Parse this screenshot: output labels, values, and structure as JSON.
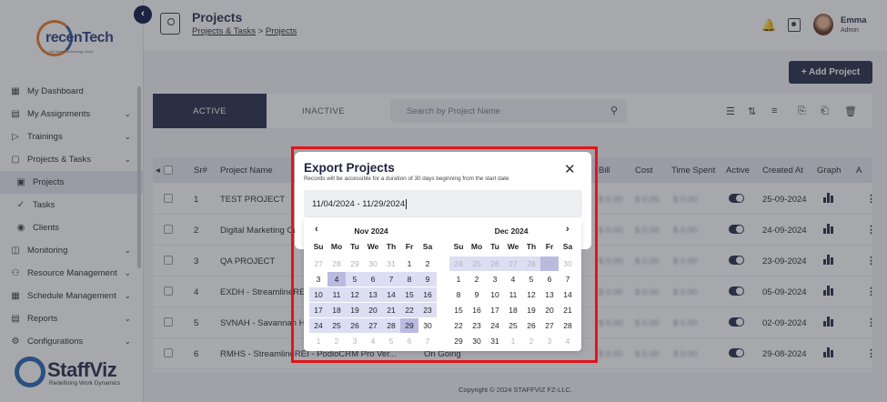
{
  "sidebar": {
    "logo_text": "recenTech",
    "logo_tagline": "We Make Technology Work",
    "items": [
      {
        "label": "My Dashboard",
        "icon": "dashboard-icon",
        "chevron": false
      },
      {
        "label": "My Assignments",
        "icon": "clipboard-icon",
        "chevron": true
      },
      {
        "label": "Trainings",
        "icon": "play-icon",
        "chevron": true
      },
      {
        "label": "Projects & Tasks",
        "icon": "folder-icon",
        "chevron": true
      },
      {
        "label": "Projects",
        "icon": "project-icon",
        "chevron": false,
        "sub": true,
        "active": true
      },
      {
        "label": "Tasks",
        "icon": "check-icon",
        "chevron": false,
        "sub": true
      },
      {
        "label": "Clients",
        "icon": "person-icon",
        "chevron": false,
        "sub": true
      },
      {
        "label": "Monitoring",
        "icon": "monitor-icon",
        "chevron": true
      },
      {
        "label": "Resource Management",
        "icon": "people-icon",
        "chevron": true
      },
      {
        "label": "Schedule Management",
        "icon": "calendar-icon",
        "chevron": true
      },
      {
        "label": "Reports",
        "icon": "report-icon",
        "chevron": true
      },
      {
        "label": "Configurations",
        "icon": "gear-icon",
        "chevron": true
      }
    ],
    "brand_name": "StaffViz",
    "brand_tagline": "Redefining Work Dynamics"
  },
  "header": {
    "title": "Projects",
    "crumb_parent": "Projects & Tasks",
    "crumb_sep": ">",
    "crumb_current": "Projects",
    "user_name": "Emma",
    "user_role": "Admin"
  },
  "main": {
    "add_button": "+ Add Project",
    "tab_active": "ACTIVE",
    "tab_inactive": "INACTIVE",
    "search_placeholder": "Search by Project Name",
    "columns": [
      "Sr#",
      "Project Name",
      "Bill",
      "Cost",
      "Time Spent",
      "Active",
      "Created At",
      "Graph",
      "A"
    ],
    "rows": [
      {
        "sr": "1",
        "name": "TEST PROJECT",
        "created": "25-09-2024"
      },
      {
        "sr": "2",
        "name": "Digital Marketing Ca",
        "created": "24-09-2024"
      },
      {
        "sr": "3",
        "name": "QA PROJECT",
        "created": "23-09-2024"
      },
      {
        "sr": "4",
        "name": "EXDH - StreamlineREI",
        "created": "05-09-2024"
      },
      {
        "sr": "5",
        "name": "SVNAH - Savannah Ho",
        "created": "02-09-2024"
      },
      {
        "sr": "6",
        "name": "RMHS - StreamlineREI - PodioCRM Pro Ver...",
        "status": "On Going",
        "created": "29-08-2024"
      }
    ],
    "masked_value": "$ 0.00",
    "footer": "Copyright © 2024 STAFFVIZ FZ-LLC."
  },
  "modal": {
    "title": "Export Projects",
    "subtitle": "Records will be accessible for a duration of 30 days beginning from the start date",
    "date_range": "11/04/2024 - 11/29/2024",
    "weekdays": [
      "Su",
      "Mo",
      "Tu",
      "We",
      "Th",
      "Fr",
      "Sa"
    ],
    "left_month": "Nov 2024",
    "right_month": "Dec 2024",
    "left_days": [
      [
        "27",
        "28",
        "29",
        "30",
        "31",
        "1",
        "2"
      ],
      [
        "3",
        "4",
        "5",
        "6",
        "7",
        "8",
        "9"
      ],
      [
        "10",
        "11",
        "12",
        "13",
        "14",
        "15",
        "16"
      ],
      [
        "17",
        "18",
        "19",
        "20",
        "21",
        "22",
        "23"
      ],
      [
        "24",
        "25",
        "26",
        "27",
        "28",
        "29",
        "30"
      ],
      [
        "1",
        "2",
        "3",
        "4",
        "5",
        "6",
        "7"
      ]
    ],
    "right_days": [
      [
        "24",
        "25",
        "26",
        "27",
        "28",
        "29",
        "30"
      ],
      [
        "1",
        "2",
        "3",
        "4",
        "5",
        "6",
        "7"
      ],
      [
        "8",
        "9",
        "10",
        "11",
        "12",
        "13",
        "14"
      ],
      [
        "15",
        "16",
        "17",
        "18",
        "19",
        "20",
        "21"
      ],
      [
        "22",
        "23",
        "24",
        "25",
        "26",
        "27",
        "28"
      ],
      [
        "29",
        "30",
        "31",
        "1",
        "2",
        "3",
        "4"
      ]
    ]
  }
}
